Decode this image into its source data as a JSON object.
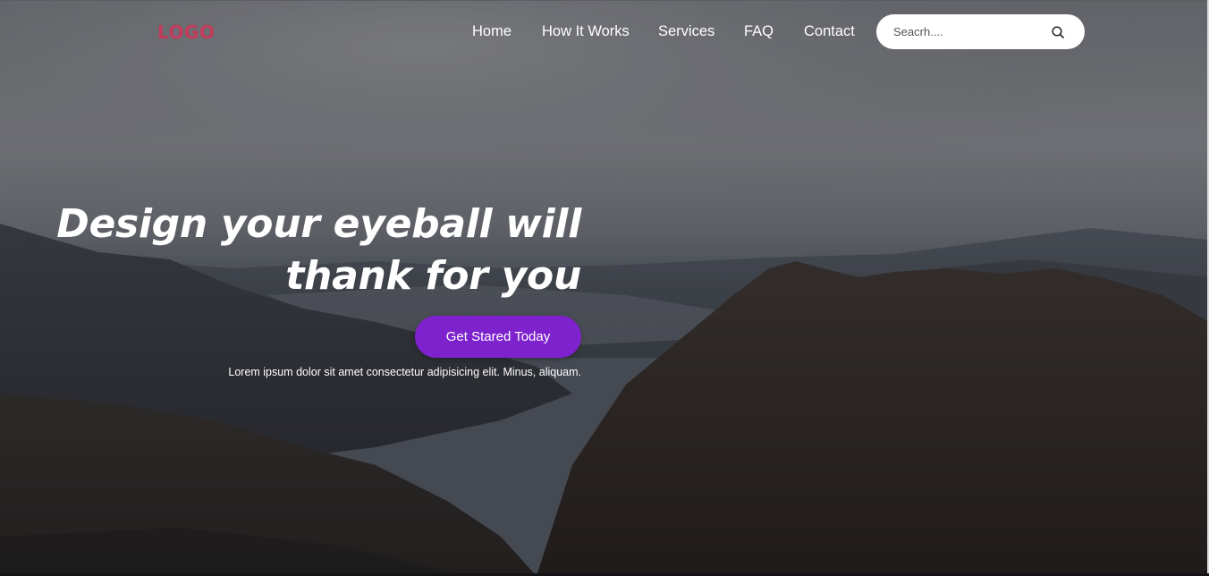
{
  "header": {
    "logo_text": "LOGO",
    "nav": [
      {
        "label": "Home"
      },
      {
        "label": "How It Works"
      },
      {
        "label": "Services"
      },
      {
        "label": "FAQ"
      },
      {
        "label": "Contact"
      }
    ],
    "search": {
      "placeholder": "Seacrh....",
      "value": "",
      "icon": "search-icon"
    }
  },
  "hero": {
    "headline_line1": "Design your eyeball will",
    "headline_line2": "thank for you",
    "cta_label": "Get Stared Today",
    "subtext": "Lorem ipsum dolor sit amet consectetur adipisicing elit. Minus, aliquam."
  },
  "colors": {
    "logo": "#c43a5c",
    "cta_background": "#7e22ce",
    "nav_text": "#ffffff",
    "search_background": "#ffffff"
  }
}
